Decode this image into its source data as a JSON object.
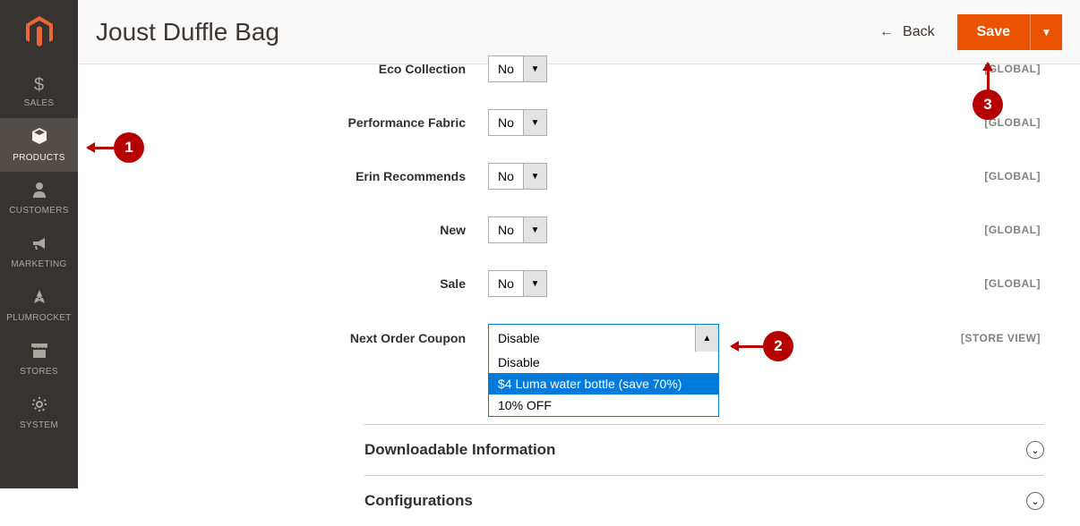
{
  "header": {
    "title": "Joust Duffle Bag",
    "back_label": "Back",
    "save_label": "Save"
  },
  "sidebar": {
    "items": [
      {
        "label": "SALES",
        "icon": "$"
      },
      {
        "label": "PRODUCTS",
        "icon": "cube"
      },
      {
        "label": "CUSTOMERS",
        "icon": "person"
      },
      {
        "label": "MARKETING",
        "icon": "megaphone"
      },
      {
        "label": "PLUMROCKET",
        "icon": "rocket"
      },
      {
        "label": "STORES",
        "icon": "store"
      },
      {
        "label": "SYSTEM",
        "icon": "gear"
      }
    ]
  },
  "form": {
    "eco_collection": {
      "label": "Eco Collection",
      "value": "No",
      "scope": "[GLOBAL]"
    },
    "performance_fabric": {
      "label": "Performance Fabric",
      "value": "No",
      "scope": "[GLOBAL]"
    },
    "erin_recommends": {
      "label": "Erin Recommends",
      "value": "No",
      "scope": "[GLOBAL]"
    },
    "new": {
      "label": "New",
      "value": "No",
      "scope": "[GLOBAL]"
    },
    "sale": {
      "label": "Sale",
      "value": "No",
      "scope": "[GLOBAL]"
    },
    "next_order_coupon": {
      "label": "Next Order Coupon",
      "value": "Disable",
      "scope": "[STORE VIEW]",
      "options": [
        "Disable",
        "$4 Luma water bottle (save 70%)",
        "10% OFF"
      ]
    }
  },
  "sections": {
    "downloadable": "Downloadable Information",
    "configurations": "Configurations"
  },
  "annotations": {
    "a1": "1",
    "a2": "2",
    "a3": "3"
  }
}
